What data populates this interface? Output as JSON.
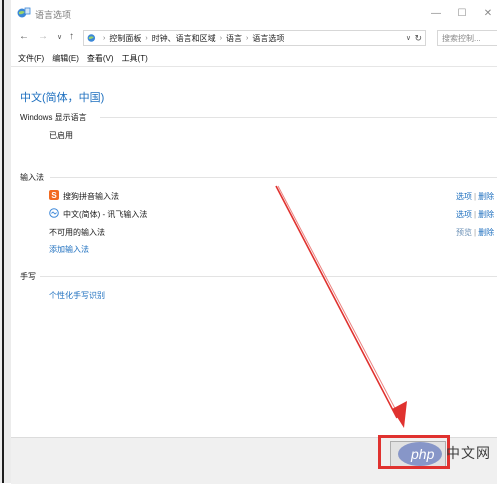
{
  "window": {
    "title": "语言选项"
  },
  "address": {
    "crumbs": [
      "控制面板",
      "时钟、语言和区域",
      "语言",
      "语言选项"
    ],
    "search_placeholder": "搜索控制..."
  },
  "menu": [
    "文件(F)",
    "编辑(E)",
    "查看(V)",
    "工具(T)"
  ],
  "language": {
    "title": "中文(简体，中国)",
    "display_section": "Windows 显示语言",
    "display_status": "已启用"
  },
  "input": {
    "section": "输入法",
    "methods": [
      {
        "label": "搜狗拼音输入法",
        "action1": "选项",
        "action2": "删除",
        "icon": "sogou-icon"
      },
      {
        "label": "中文(简体) - 讯飞输入法",
        "action1": "选项",
        "action2": "删除",
        "icon": "iflytek-icon"
      },
      {
        "label": "不可用的输入法",
        "action1": "预览",
        "action2": "删除"
      }
    ],
    "add": "添加输入法"
  },
  "handwriting": {
    "section": "手写",
    "link": "个性化手写识别"
  },
  "watermark": {
    "brand": "php",
    "cn": "中文网"
  },
  "colors": {
    "link": "#1d6fbf",
    "highlight": "#e0322f",
    "arrow": "#e0322f"
  }
}
